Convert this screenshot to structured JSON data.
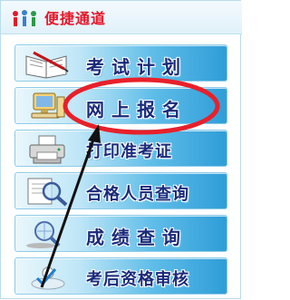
{
  "header": {
    "title": "便捷通道",
    "icon": "people-icon"
  },
  "menu": [
    {
      "label": "考试计划",
      "icon": "book-pen-icon"
    },
    {
      "label": "网上报名",
      "icon": "computer-icon"
    },
    {
      "label": "打印准考证",
      "icon": "printer-icon"
    },
    {
      "label": "合格人员查询",
      "icon": "magnifier-icon"
    },
    {
      "label": "成绩查询",
      "icon": "search-globe-icon"
    },
    {
      "label": "考后资格审核",
      "icon": "checkmark-person-icon"
    }
  ],
  "annotations": {
    "highlight_color": "#e8202a",
    "arrow_color": "#111111",
    "highlighted_item": "网上报名"
  }
}
